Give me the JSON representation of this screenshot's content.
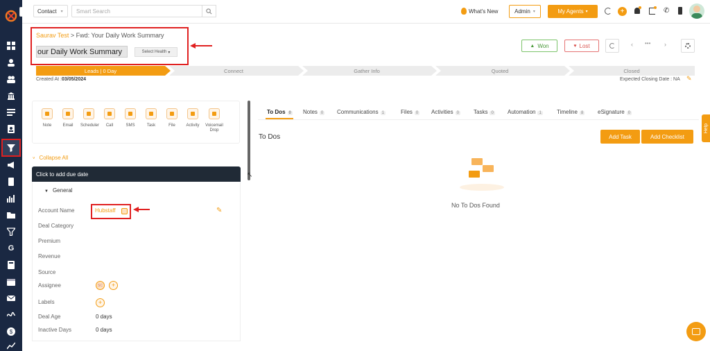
{
  "topbar": {
    "module": "Contact",
    "search_placeholder": "Smart Search",
    "whats_new": "What's New",
    "role": "Admin",
    "agents": "My Agents"
  },
  "header": {
    "breadcrumb_root": "Saurav Test",
    "breadcrumb_sep": ">",
    "breadcrumb_title": "Fwd: Your Daily Work Summary",
    "title_value": "our Daily Work Summary",
    "health": "Select Health",
    "won": "Won",
    "lost": "Lost",
    "more": "•••"
  },
  "pipeline": {
    "stages": [
      "Leads | 0 Day",
      "Connect",
      "Gather Info",
      "Quoted",
      "Closed"
    ],
    "created_label": "Created At :",
    "created_value": "03/05/2024",
    "closing_label": "Expected Closing Date : NA"
  },
  "quick_actions": [
    {
      "label": "Note"
    },
    {
      "label": "Email"
    },
    {
      "label": "Scheduler"
    },
    {
      "label": "Call"
    },
    {
      "label": "SMS"
    },
    {
      "label": "Task"
    },
    {
      "label": "File"
    },
    {
      "label": "Activity"
    },
    {
      "label": "Voicemail Drop"
    }
  ],
  "details": {
    "collapse": "Collapse All",
    "due_date": "Click to add due date",
    "section": "General",
    "account_label": "Account Name",
    "account_value": "Hubstaff",
    "deal_category": "Deal Category",
    "premium": "Premium",
    "revenue": "Revenue",
    "source": "Source",
    "assignee": "Assignee",
    "assignee_initials": "SC",
    "labels": "Labels",
    "deal_age_label": "Deal Age",
    "deal_age_value": "0 days",
    "inactive_label": "Inactive Days",
    "inactive_value": "0 days"
  },
  "tabs": [
    {
      "label": "To Dos",
      "count": "0"
    },
    {
      "label": "Notes",
      "count": "0"
    },
    {
      "label": "Communications",
      "count": "1"
    },
    {
      "label": "Files",
      "count": "0"
    },
    {
      "label": "Activities",
      "count": "0"
    },
    {
      "label": "Tasks",
      "count": "0"
    },
    {
      "label": "Automation",
      "count": "1"
    },
    {
      "label": "Timeline",
      "count": "8"
    },
    {
      "label": "eSignature",
      "count": "0"
    }
  ],
  "todos": {
    "heading": "To Dos",
    "add_task": "Add Task",
    "add_checklist": "Add Checklist",
    "empty": "No To Dos Found"
  },
  "help": "Help",
  "colors": {
    "accent": "#f39c12",
    "sidebar": "#1a2842",
    "annotation": "#e02020"
  }
}
